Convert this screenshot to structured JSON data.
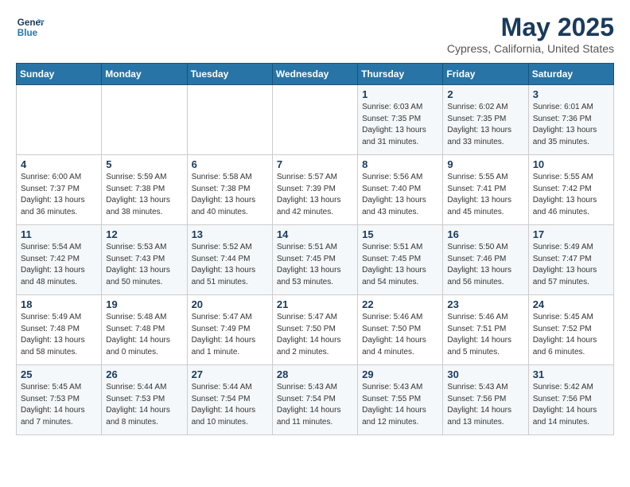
{
  "header": {
    "logo_line1": "General",
    "logo_line2": "Blue",
    "month": "May 2025",
    "location": "Cypress, California, United States"
  },
  "weekdays": [
    "Sunday",
    "Monday",
    "Tuesday",
    "Wednesday",
    "Thursday",
    "Friday",
    "Saturday"
  ],
  "weeks": [
    [
      {
        "day": "",
        "info": ""
      },
      {
        "day": "",
        "info": ""
      },
      {
        "day": "",
        "info": ""
      },
      {
        "day": "",
        "info": ""
      },
      {
        "day": "1",
        "info": "Sunrise: 6:03 AM\nSunset: 7:35 PM\nDaylight: 13 hours\nand 31 minutes."
      },
      {
        "day": "2",
        "info": "Sunrise: 6:02 AM\nSunset: 7:35 PM\nDaylight: 13 hours\nand 33 minutes."
      },
      {
        "day": "3",
        "info": "Sunrise: 6:01 AM\nSunset: 7:36 PM\nDaylight: 13 hours\nand 35 minutes."
      }
    ],
    [
      {
        "day": "4",
        "info": "Sunrise: 6:00 AM\nSunset: 7:37 PM\nDaylight: 13 hours\nand 36 minutes."
      },
      {
        "day": "5",
        "info": "Sunrise: 5:59 AM\nSunset: 7:38 PM\nDaylight: 13 hours\nand 38 minutes."
      },
      {
        "day": "6",
        "info": "Sunrise: 5:58 AM\nSunset: 7:38 PM\nDaylight: 13 hours\nand 40 minutes."
      },
      {
        "day": "7",
        "info": "Sunrise: 5:57 AM\nSunset: 7:39 PM\nDaylight: 13 hours\nand 42 minutes."
      },
      {
        "day": "8",
        "info": "Sunrise: 5:56 AM\nSunset: 7:40 PM\nDaylight: 13 hours\nand 43 minutes."
      },
      {
        "day": "9",
        "info": "Sunrise: 5:55 AM\nSunset: 7:41 PM\nDaylight: 13 hours\nand 45 minutes."
      },
      {
        "day": "10",
        "info": "Sunrise: 5:55 AM\nSunset: 7:42 PM\nDaylight: 13 hours\nand 46 minutes."
      }
    ],
    [
      {
        "day": "11",
        "info": "Sunrise: 5:54 AM\nSunset: 7:42 PM\nDaylight: 13 hours\nand 48 minutes."
      },
      {
        "day": "12",
        "info": "Sunrise: 5:53 AM\nSunset: 7:43 PM\nDaylight: 13 hours\nand 50 minutes."
      },
      {
        "day": "13",
        "info": "Sunrise: 5:52 AM\nSunset: 7:44 PM\nDaylight: 13 hours\nand 51 minutes."
      },
      {
        "day": "14",
        "info": "Sunrise: 5:51 AM\nSunset: 7:45 PM\nDaylight: 13 hours\nand 53 minutes."
      },
      {
        "day": "15",
        "info": "Sunrise: 5:51 AM\nSunset: 7:45 PM\nDaylight: 13 hours\nand 54 minutes."
      },
      {
        "day": "16",
        "info": "Sunrise: 5:50 AM\nSunset: 7:46 PM\nDaylight: 13 hours\nand 56 minutes."
      },
      {
        "day": "17",
        "info": "Sunrise: 5:49 AM\nSunset: 7:47 PM\nDaylight: 13 hours\nand 57 minutes."
      }
    ],
    [
      {
        "day": "18",
        "info": "Sunrise: 5:49 AM\nSunset: 7:48 PM\nDaylight: 13 hours\nand 58 minutes."
      },
      {
        "day": "19",
        "info": "Sunrise: 5:48 AM\nSunset: 7:48 PM\nDaylight: 14 hours\nand 0 minutes."
      },
      {
        "day": "20",
        "info": "Sunrise: 5:47 AM\nSunset: 7:49 PM\nDaylight: 14 hours\nand 1 minute."
      },
      {
        "day": "21",
        "info": "Sunrise: 5:47 AM\nSunset: 7:50 PM\nDaylight: 14 hours\nand 2 minutes."
      },
      {
        "day": "22",
        "info": "Sunrise: 5:46 AM\nSunset: 7:50 PM\nDaylight: 14 hours\nand 4 minutes."
      },
      {
        "day": "23",
        "info": "Sunrise: 5:46 AM\nSunset: 7:51 PM\nDaylight: 14 hours\nand 5 minutes."
      },
      {
        "day": "24",
        "info": "Sunrise: 5:45 AM\nSunset: 7:52 PM\nDaylight: 14 hours\nand 6 minutes."
      }
    ],
    [
      {
        "day": "25",
        "info": "Sunrise: 5:45 AM\nSunset: 7:53 PM\nDaylight: 14 hours\nand 7 minutes."
      },
      {
        "day": "26",
        "info": "Sunrise: 5:44 AM\nSunset: 7:53 PM\nDaylight: 14 hours\nand 8 minutes."
      },
      {
        "day": "27",
        "info": "Sunrise: 5:44 AM\nSunset: 7:54 PM\nDaylight: 14 hours\nand 10 minutes."
      },
      {
        "day": "28",
        "info": "Sunrise: 5:43 AM\nSunset: 7:54 PM\nDaylight: 14 hours\nand 11 minutes."
      },
      {
        "day": "29",
        "info": "Sunrise: 5:43 AM\nSunset: 7:55 PM\nDaylight: 14 hours\nand 12 minutes."
      },
      {
        "day": "30",
        "info": "Sunrise: 5:43 AM\nSunset: 7:56 PM\nDaylight: 14 hours\nand 13 minutes."
      },
      {
        "day": "31",
        "info": "Sunrise: 5:42 AM\nSunset: 7:56 PM\nDaylight: 14 hours\nand 14 minutes."
      }
    ]
  ]
}
